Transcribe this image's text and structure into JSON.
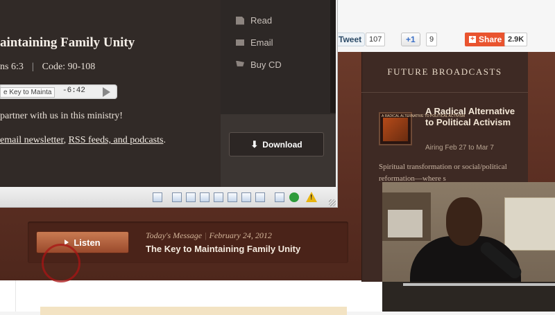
{
  "social": {
    "tweet_label": "Tweet",
    "tweet_count": "107",
    "plusone_label": "+1",
    "plusone_count": "9",
    "share_label": "Share",
    "share_count": "2.9K"
  },
  "sidebar": {
    "title": "FUTURE BROADCASTS",
    "thumb_caption": "A RADICAL ALTERNATIVE TO POLITICAL ACTIVISM",
    "headline": "A Radical Alternative to Political Activism",
    "airing": "Airing Feb 27 to Mar 7",
    "description": "Spiritual transformation or social/political reformation—where s"
  },
  "listen": {
    "button_label": "Listen",
    "today_label": "Today's Message",
    "date": "February 24, 2012",
    "title": "The Key to Maintaining Family Unity"
  },
  "player": {
    "title": "aintaining Family Unity",
    "scripture": "ns 6:3",
    "code": "Code: 90-108",
    "track": "e Key to Mainta",
    "time": "-6:42",
    "partner_text": "partner with us in this ministry!",
    "links": {
      "newsletter": "email newsletter",
      "sep1": ",",
      "rss": "RSS feeds, and podcasts",
      "end": "."
    },
    "menu": [
      {
        "icon": "document-icon",
        "label": "Read"
      },
      {
        "icon": "mail-icon",
        "label": "Email"
      },
      {
        "icon": "cart-icon",
        "label": "Buy CD"
      }
    ],
    "download_label": "Download"
  }
}
